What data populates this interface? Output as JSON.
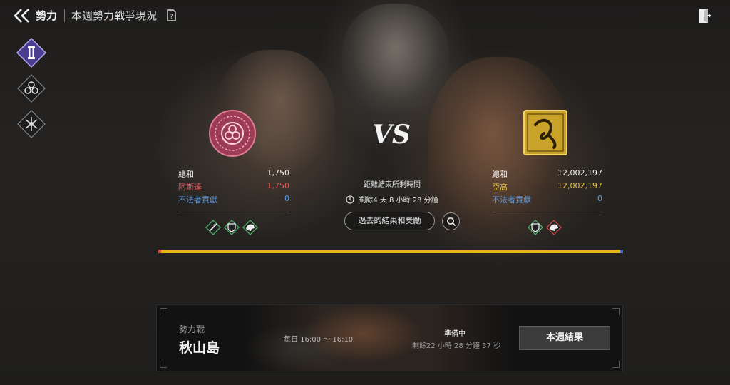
{
  "header": {
    "title": "勢力",
    "subtitle": "本週勢力戰爭現況"
  },
  "side_nav": {
    "items": [
      {
        "icon": "faction-pillar-icon",
        "active": true
      },
      {
        "icon": "triple-circle-icon",
        "active": false
      },
      {
        "icon": "crest-icon",
        "active": false
      }
    ]
  },
  "left_faction": {
    "total_label": "總和",
    "total_value": "1,750",
    "faction_name": "阿斯達",
    "faction_value": "1,750",
    "outlaw_label": "不法者貢獻",
    "outlaw_value": "0",
    "color": "#e25a5a"
  },
  "right_faction": {
    "total_label": "總和",
    "total_value": "12,002,197",
    "faction_name": "亞高",
    "faction_value": "12,002,197",
    "outlaw_label": "不法者貢獻",
    "outlaw_value": "0",
    "color": "#e7c24a"
  },
  "vs_label": "VS",
  "time_remaining": {
    "label": "距離結束所剩時間",
    "value": "剩餘4 天 8 小時 28 分鐘"
  },
  "past_results_button": "過去的結果和獎勵",
  "progress": {
    "left_fraction": 0.0001,
    "right_fraction": 0.9999,
    "left_color": "#d04848",
    "right_color": "#4a6ec8",
    "middle_color": "#e1b31c"
  },
  "war_card": {
    "type": "勢力戰",
    "place": "秋山島",
    "schedule": "每日  16:00 ～ 16:10",
    "status": "準備中",
    "remaining": "剩餘22 小時 28 分鐘 37 秒",
    "button": "本週結果"
  }
}
